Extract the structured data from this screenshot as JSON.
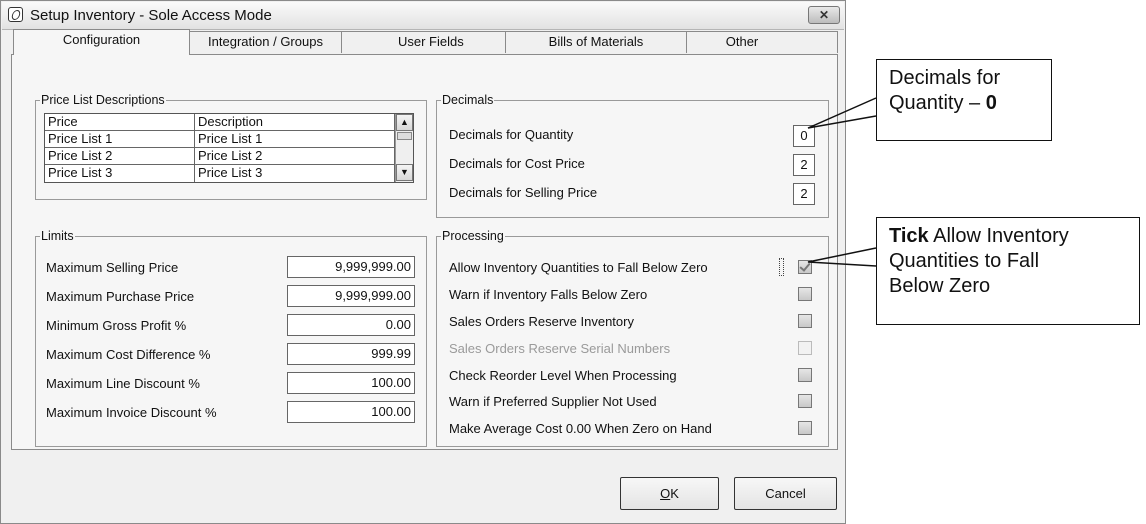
{
  "window": {
    "title": "Setup Inventory - Sole Access Mode",
    "close_glyph": "✕"
  },
  "tabs": [
    {
      "label": "Configuration",
      "active": true
    },
    {
      "label": "Integration / Groups",
      "active": false
    },
    {
      "label": "User Fields",
      "active": false
    },
    {
      "label": "Bills of Materials",
      "active": false
    },
    {
      "label": "Other",
      "active": false
    }
  ],
  "price_list": {
    "legend": "Price List Descriptions",
    "columns": [
      "Price",
      "Description"
    ],
    "rows": [
      [
        "Price List 1",
        "Price List 1"
      ],
      [
        "Price List 2",
        "Price List 2"
      ],
      [
        "Price List 3",
        "Price List 3"
      ]
    ]
  },
  "decimals": {
    "legend": "Decimals",
    "items": [
      {
        "label": "Decimals for Quantity",
        "value": "0"
      },
      {
        "label": "Decimals for Cost Price",
        "value": "2"
      },
      {
        "label": "Decimals for Selling Price",
        "value": "2"
      }
    ]
  },
  "limits": {
    "legend": "Limits",
    "items": [
      {
        "label": "Maximum Selling Price",
        "value": "9,999,999.00"
      },
      {
        "label": "Maximum Purchase Price",
        "value": "9,999,999.00"
      },
      {
        "label": "Minimum Gross Profit %",
        "value": "0.00"
      },
      {
        "label": "Maximum Cost Difference %",
        "value": "999.99"
      },
      {
        "label": "Maximum Line Discount %",
        "value": "100.00"
      },
      {
        "label": "Maximum Invoice Discount %",
        "value": "100.00"
      }
    ]
  },
  "processing": {
    "legend": "Processing",
    "items": [
      {
        "label": "Allow Inventory Quantities to Fall Below Zero",
        "checked": true,
        "enabled": true
      },
      {
        "label": "Warn if Inventory Falls Below Zero",
        "checked": false,
        "enabled": true
      },
      {
        "label": "Sales Orders Reserve Inventory",
        "checked": false,
        "enabled": true
      },
      {
        "label": "Sales Orders Reserve Serial Numbers",
        "checked": false,
        "enabled": false
      },
      {
        "label": "Check Reorder Level When Processing",
        "checked": false,
        "enabled": true
      },
      {
        "label": "Warn if Preferred Supplier Not Used",
        "checked": false,
        "enabled": true
      },
      {
        "label": "Make Average Cost 0.00 When Zero on Hand",
        "checked": false,
        "enabled": true
      }
    ]
  },
  "buttons": {
    "ok_underlined": "O",
    "ok_rest": "K",
    "cancel": "Cancel"
  },
  "callouts": {
    "decimals": {
      "line1": "Decimals for",
      "line2_text": "Quantity – ",
      "line2_bold": "0"
    },
    "tick": {
      "bold": "Tick",
      "line1_rest": " Allow Inventory",
      "line2": "Quantities to Fall",
      "line3": "Below Zero"
    }
  }
}
